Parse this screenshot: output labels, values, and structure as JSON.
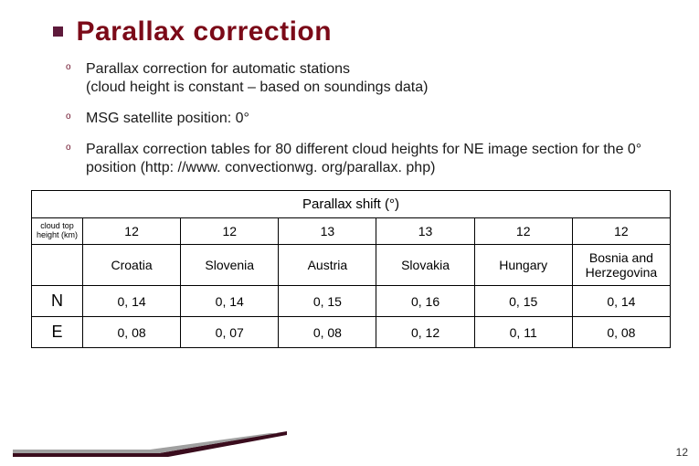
{
  "title": "Parallax correction",
  "bullets": [
    "Parallax correction for automatic stations\n(cloud height is constant – based on soundings data)",
    "MSG satellite position: 0°",
    "Parallax correction tables for 80 different cloud heights for NE image section for the 0° position "
  ],
  "bullet3_link_text": "(http: //www. convectionwg. org/parallax. php)",
  "table": {
    "caption": "Parallax shift (°)",
    "row_header_label": "cloud top height (km)",
    "heights": [
      "12",
      "12",
      "13",
      "13",
      "12",
      "12"
    ],
    "countries": [
      "Croatia",
      "Slovenia",
      "Austria",
      "Slovakia",
      "Hungary",
      "Bosnia and Herzegovina"
    ],
    "rows": [
      {
        "label": "N",
        "values": [
          "0, 14",
          "0, 14",
          "0, 15",
          "0, 16",
          "0, 15",
          "0, 14"
        ]
      },
      {
        "label": "E",
        "values": [
          "0, 08",
          "0, 07",
          "0, 08",
          "0, 12",
          "0, 11",
          "0, 08"
        ]
      }
    ]
  },
  "page_number": "12",
  "chart_data": {
    "type": "table",
    "title": "Parallax shift (°)",
    "columns": [
      "Croatia",
      "Slovenia",
      "Austria",
      "Slovakia",
      "Hungary",
      "Bosnia and Herzegovina"
    ],
    "column_meta_cloud_top_height_km": [
      12,
      12,
      13,
      13,
      12,
      12
    ],
    "rows": {
      "N": [
        0.14,
        0.14,
        0.15,
        0.16,
        0.15,
        0.14
      ],
      "E": [
        0.08,
        0.07,
        0.08,
        0.12,
        0.11,
        0.08
      ]
    }
  }
}
